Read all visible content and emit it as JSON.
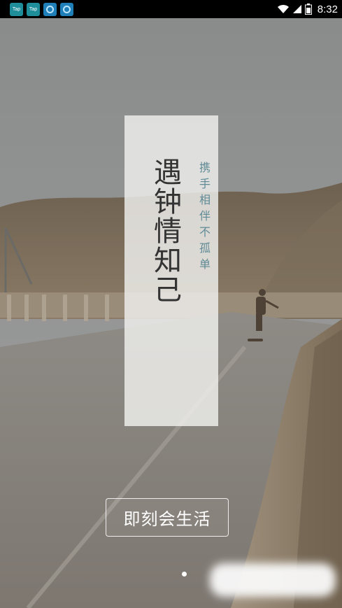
{
  "status_bar": {
    "notification_icons": [
      {
        "name": "taptap-icon",
        "label": "Tap"
      },
      {
        "name": "taptap-icon",
        "label": "Tap"
      },
      {
        "name": "browser-icon",
        "label": ""
      },
      {
        "name": "browser-icon",
        "label": ""
      }
    ],
    "time": "8:32",
    "indicators": [
      "wifi-icon",
      "signal-icon",
      "battery-icon"
    ]
  },
  "splash": {
    "title": "遇钟情知己",
    "subtitle": "携手相伴不孤单",
    "start_button_label": "即刻会生活",
    "pager": {
      "count": 1,
      "active_index": 0
    }
  },
  "colors": {
    "card_bg": "#f0f0ee",
    "title_text": "#333333",
    "subtitle_text": "#5f8a96",
    "button_border": "#ffffff"
  }
}
